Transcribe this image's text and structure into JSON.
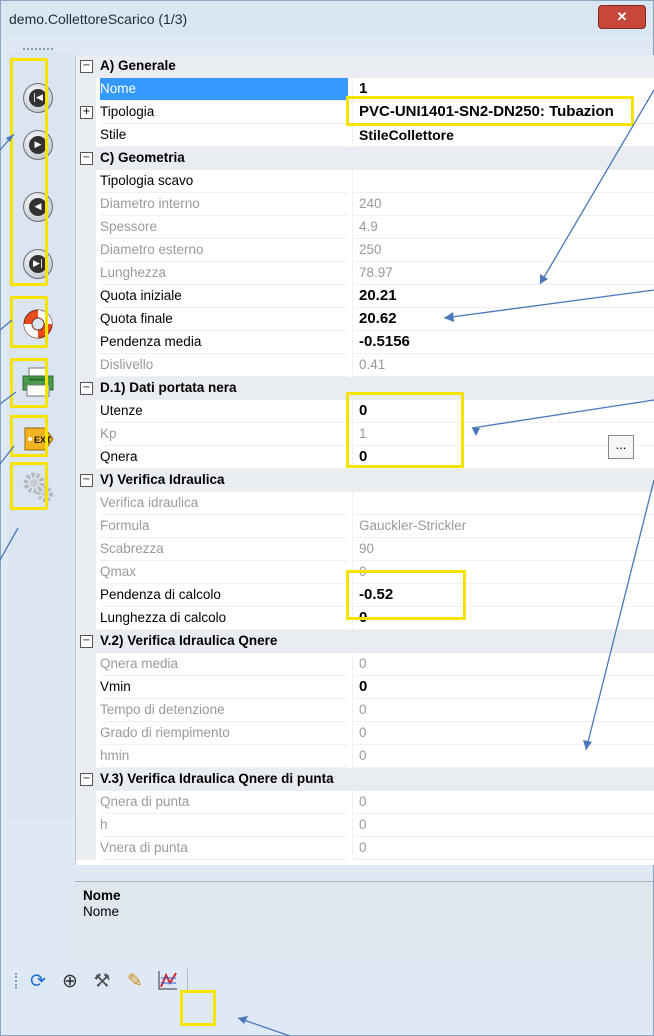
{
  "window": {
    "title": "demo.CollettoreScarico (1/3)",
    "close_glyph": "✕"
  },
  "toolbar_left": {
    "buttons": [
      {
        "name": "first-record",
        "glyph": "|◀"
      },
      {
        "name": "next-record",
        "glyph": "▶"
      },
      {
        "name": "previous-record",
        "glyph": "◀"
      },
      {
        "name": "last-record",
        "glyph": "▶|"
      },
      {
        "name": "help",
        "icon": "lifebuoy-icon"
      },
      {
        "name": "print",
        "icon": "printer-icon"
      },
      {
        "name": "ext",
        "label": "EXT"
      },
      {
        "name": "settings",
        "icon": "gears-icon"
      }
    ]
  },
  "properties": {
    "cat_a": "A) Generale",
    "nome_label": "Nome",
    "nome_val": "1",
    "tipologia_label": "Tipologia",
    "tipologia_val": "PVC-UNI1401-SN2-DN250: Tubazion",
    "stile_label": "Stile",
    "stile_val": "StileCollettore",
    "cat_c": "C) Geometria",
    "tscavo_label": "Tipologia scavo",
    "tscavo_val": "",
    "dint_label": "Diametro interno",
    "dint_val": "240",
    "spess_label": "Spessore",
    "spess_val": "4.9",
    "dest_label": "Diametro esterno",
    "dest_val": "250",
    "lung_label": "Lunghezza",
    "lung_val": "78.97",
    "qi_label": "Quota iniziale",
    "qi_val": "20.21",
    "qf_label": "Quota finale",
    "qf_val": "20.62",
    "pm_label": "Pendenza media",
    "pm_val": "-0.5156",
    "disl_label": "Dislivello",
    "disl_val": "0.41",
    "cat_d1": "D.1) Dati portata nera",
    "ut_label": "Utenze",
    "ut_val": "0",
    "kp_label": "Kp",
    "kp_val": "1",
    "qn_label": "Qnera",
    "qn_val": "0",
    "cat_v": "V) Verifica Idraulica",
    "vi_label": "Verifica idraulica",
    "vi_val": "",
    "form_label": "Formula",
    "form_val": "Gauckler-Strickler",
    "scab_label": "Scabrezza",
    "scab_val": "90",
    "qmax_label": "Qmax",
    "qmax_val": "0",
    "pdc_label": "Pendenza di calcolo",
    "pdc_val": "-0.52",
    "ldc_label": "Lunghezza di calcolo",
    "ldc_val": "0",
    "cat_v2": "V.2) Verifica Idraulica Qnere",
    "qnm_label": "Qnera media",
    "qnm_val": "0",
    "vmin_label": "Vmin",
    "vmin_val": "0",
    "tdd_label": "Tempo di detenzione",
    "tdd_val": "0",
    "gdr_label": "Grado di riempimento",
    "gdr_val": "0",
    "hmin_label": "hmin",
    "hmin_val": "0",
    "cat_v3": "V.3) Verifica Idraulica Qnere di punta",
    "qndp_label": "Qnera di punta",
    "qndp_val": "0",
    "h_label": "h",
    "h_val": "0",
    "vndp_label": "Vnera di punta",
    "vndp_val": "0",
    "ellipsis": "..."
  },
  "description": {
    "title": "Nome",
    "text": "Nome"
  },
  "toolbar_bottom": {
    "icons": [
      "refresh-icon",
      "zoom-icon",
      "tools-icon",
      "pencil-icon",
      "chart-icon"
    ]
  },
  "colors": {
    "selection": "#3399ff",
    "highlight": "#f4e400",
    "annotation": "#4a78b8"
  }
}
